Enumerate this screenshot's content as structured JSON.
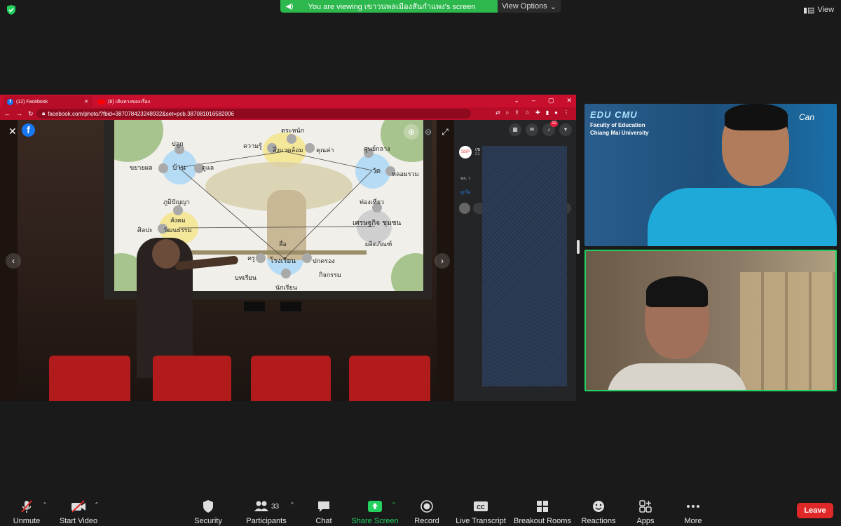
{
  "top_bar": {
    "banner_text": "You are viewing เขาวนพลเมืองสันกำแพง's screen",
    "view_options_label": "View Options",
    "view_label": "View",
    "banner_color": "#2db84d"
  },
  "browser": {
    "tabs": [
      {
        "label": "(12) Facebook",
        "icon": "facebook-icon"
      },
      {
        "label": "(6) เส้นทางของเรื่อง",
        "icon": "youtube-icon"
      }
    ],
    "url": "facebook.com/photo/?fbid=387078423248932&set=pcb.387081016582006",
    "accent_color": "#c8102e"
  },
  "projection": {
    "labels": {
      "plant": "ปลูก",
      "home": "บ้าน",
      "expand": "ขยายผล",
      "care": "ดูแล",
      "knowledge": "ความรู้",
      "awareness": "ตระหนัก",
      "environment": "สิ่งแวดล้อม",
      "value": "คุณค่า",
      "learning_center": "ศูนย์กลาง",
      "temple": "วัด",
      "gather": "หลอมรวม",
      "wisdom": "ภูมิปัญญา",
      "society": "สังคม",
      "arts": "ศิลปะ",
      "culture": "วัฒนธรรม",
      "tourism": "ท่องเที่ยว",
      "economy": "เศรษฐกิจ ชุมชน",
      "product": "ผลิตภัณฑ์",
      "media": "สื่อ",
      "teacher": "ครู",
      "school": "โรงเรียน",
      "governance": "ปกครอง",
      "lesson": "บทเรียน",
      "activity": "กิจกรรม",
      "student": "นักเรียน"
    }
  },
  "facebook_panel": {
    "page_avatar_text": "SSP",
    "page_name": "เข",
    "post_time": "21",
    "reactions_text": "พล, ว",
    "like_text": "ถูกใจ",
    "comment_prefix": "เขี"
  },
  "video_tiles": [
    {
      "overlay_logo": "EDU CMU",
      "overlay_line1": "Faculty of Education",
      "overlay_line2": "Chiang Mai University",
      "watermark": "Can"
    },
    {
      "active_speaker": true,
      "border_color": "#23d160"
    }
  ],
  "toolbar": {
    "unmute": "Unmute",
    "start_video": "Start Video",
    "security": "Security",
    "participants": "Participants",
    "participants_count": "33",
    "chat": "Chat",
    "share_screen": "Share Screen",
    "record": "Record",
    "live_transcript": "Live Transcript",
    "breakout_rooms": "Breakout Rooms",
    "reactions": "Reactions",
    "apps": "Apps",
    "more": "More",
    "leave": "Leave",
    "leave_color": "#e02828"
  },
  "fb_notifications_count": "12"
}
